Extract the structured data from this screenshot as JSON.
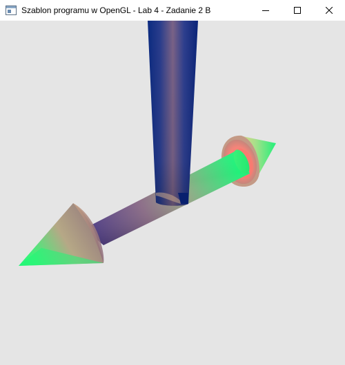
{
  "window": {
    "title": "Szablon programu w OpenGL - Lab 4 - Zadanie 2 B",
    "app_icon": "window-app-icon",
    "controls": {
      "minimize_icon": "minimize-icon",
      "maximize_icon": "maximize-icon",
      "close_icon": "close-icon"
    }
  },
  "scene": {
    "background_color": "#e5e5e5",
    "colors": {
      "navy": "#0b2a80",
      "mauve": "#8a6a86",
      "green": "#22f07a",
      "salmon": "#f58479",
      "tan": "#c8a283"
    }
  }
}
